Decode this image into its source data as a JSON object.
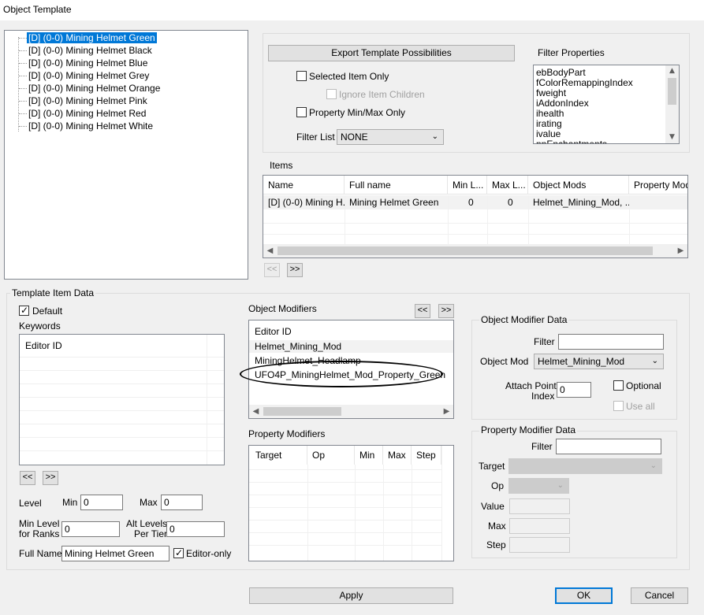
{
  "window": {
    "title": "Object Template"
  },
  "tree": {
    "items": [
      "[D] (0-0) Mining Helmet Green",
      "[D] (0-0) Mining Helmet Black",
      "[D] (0-0) Mining Helmet Blue",
      "[D] (0-0) Mining Helmet Grey",
      "[D] (0-0) Mining Helmet Orange",
      "[D] (0-0) Mining Helmet Pink",
      "[D] (0-0) Mining Helmet Red",
      "[D] (0-0) Mining Helmet White"
    ],
    "selected_index": 0
  },
  "export": {
    "button": "Export Template Possibilities",
    "selected_item_only": "Selected Item Only",
    "ignore_item_children": "Ignore Item Children",
    "property_minmax_only": "Property Min/Max Only",
    "filter_list_label": "Filter List",
    "filter_list_value": "NONE"
  },
  "filter_properties": {
    "label": "Filter Properties",
    "items": [
      "ebBodyPart",
      "fColorRemappingIndex",
      "fweight",
      "iAddonIndex",
      "ihealth",
      "irating",
      "ivalue",
      "nnEnchantments"
    ]
  },
  "items_table": {
    "label": "Items",
    "columns": [
      "Name",
      "Full name",
      "Min L...",
      "Max L...",
      "Object Mods",
      "Property Mods"
    ],
    "rows": [
      [
        "[D] (0-0) Mining H...",
        "Mining Helmet Green",
        "0",
        "0",
        "Helmet_Mining_Mod, ...",
        ""
      ]
    ],
    "prev": "<<",
    "next": ">>"
  },
  "template_item_data": {
    "label": "Template Item Data",
    "default_label": "Default",
    "default_checked": true,
    "keywords_label": "Keywords",
    "keywords_column": "Editor ID",
    "prev": "<<",
    "next": ">>",
    "level_label": "Level",
    "min_label": "Min",
    "min_value": "0",
    "max_label": "Max",
    "max_value": "0",
    "min_level_ranks_label_1": "Min Level",
    "min_level_ranks_label_2": "for Ranks",
    "min_level_ranks_value": "0",
    "alt_levels_label_1": "Alt Levels",
    "alt_levels_label_2": "Per Tier",
    "alt_levels_value": "0",
    "full_name_label": "Full Name",
    "full_name_value": "Mining Helmet Green",
    "editor_only_label": "Editor-only",
    "editor_only_checked": true
  },
  "object_modifiers": {
    "label": "Object Modifiers",
    "prev": "<<",
    "next": ">>",
    "column": "Editor ID",
    "items": [
      "Helmet_Mining_Mod",
      "MiningHelmet_Headlamp",
      "UFO4P_MiningHelmet_Mod_Property_Green"
    ]
  },
  "property_modifiers": {
    "label": "Property Modifiers",
    "columns": [
      "Target",
      "Op",
      "Min",
      "Max",
      "Step"
    ]
  },
  "object_modifier_data": {
    "label": "Object Modifier Data",
    "filter_label": "Filter",
    "filter_value": "",
    "object_mod_label": "Object Mod",
    "object_mod_value": "Helmet_Mining_Mod",
    "attach_point_label_1": "Attach Point",
    "attach_point_label_2": "Index",
    "attach_point_value": "0",
    "optional_label": "Optional",
    "use_all_label": "Use all"
  },
  "property_modifier_data": {
    "label": "Property Modifier Data",
    "filter_label": "Filter",
    "filter_value": "",
    "target_label": "Target",
    "op_label": "Op",
    "value_label": "Value",
    "max_label": "Max",
    "step_label": "Step"
  },
  "footer": {
    "apply": "Apply",
    "ok": "OK",
    "cancel": "Cancel"
  },
  "colors": {
    "selection": "#0078d7",
    "window_bg": "#f0f0f0"
  }
}
